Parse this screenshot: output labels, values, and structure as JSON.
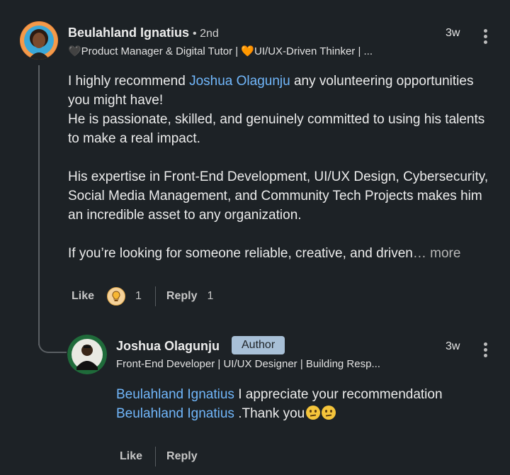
{
  "comment": {
    "author": "Beulahland Ignatius",
    "degree": "• 2nd",
    "headline": "🖤Product Manager & Digital Tutor | 🧡UI/UX-Driven Thinker | ...",
    "time": "3w",
    "body": {
      "p1_prefix": "I highly recommend ",
      "p1_mention": "Joshua Olagunju",
      "p1_suffix": "  any volunteering opportunities you might have!",
      "p2": "He is passionate, skilled, and genuinely committed to using his talents to make a real impact.",
      "p3": "His expertise in Front-End Development, UI/UX Design, Cybersecurity, Social Media Management, and Community Tech Projects makes him an incredible asset to any organization.",
      "p4": "If you’re looking for someone reliable, creative, and driven",
      "more": "… more"
    },
    "actions": {
      "like": "Like",
      "reaction_count": "1",
      "reply": "Reply",
      "reply_count": "1"
    },
    "reaction_icon": "lightbulb-icon"
  },
  "reply": {
    "author": "Joshua Olagunju",
    "badge": "Author",
    "headline": "Front-End Developer | UI/UX Designer | Building Resp...",
    "time": "3w",
    "mention1": "Beulahland Ignatius",
    "line1_text": " I appreciate your recommendation",
    "mention2": "Beulahland Ignatius",
    "line2_text": " .Thank you",
    "actions": {
      "like": "Like",
      "reply": "Reply"
    }
  },
  "colors": {
    "background": "#1d2226",
    "mention": "#71b7fb",
    "badge": "#a8c0d7"
  }
}
